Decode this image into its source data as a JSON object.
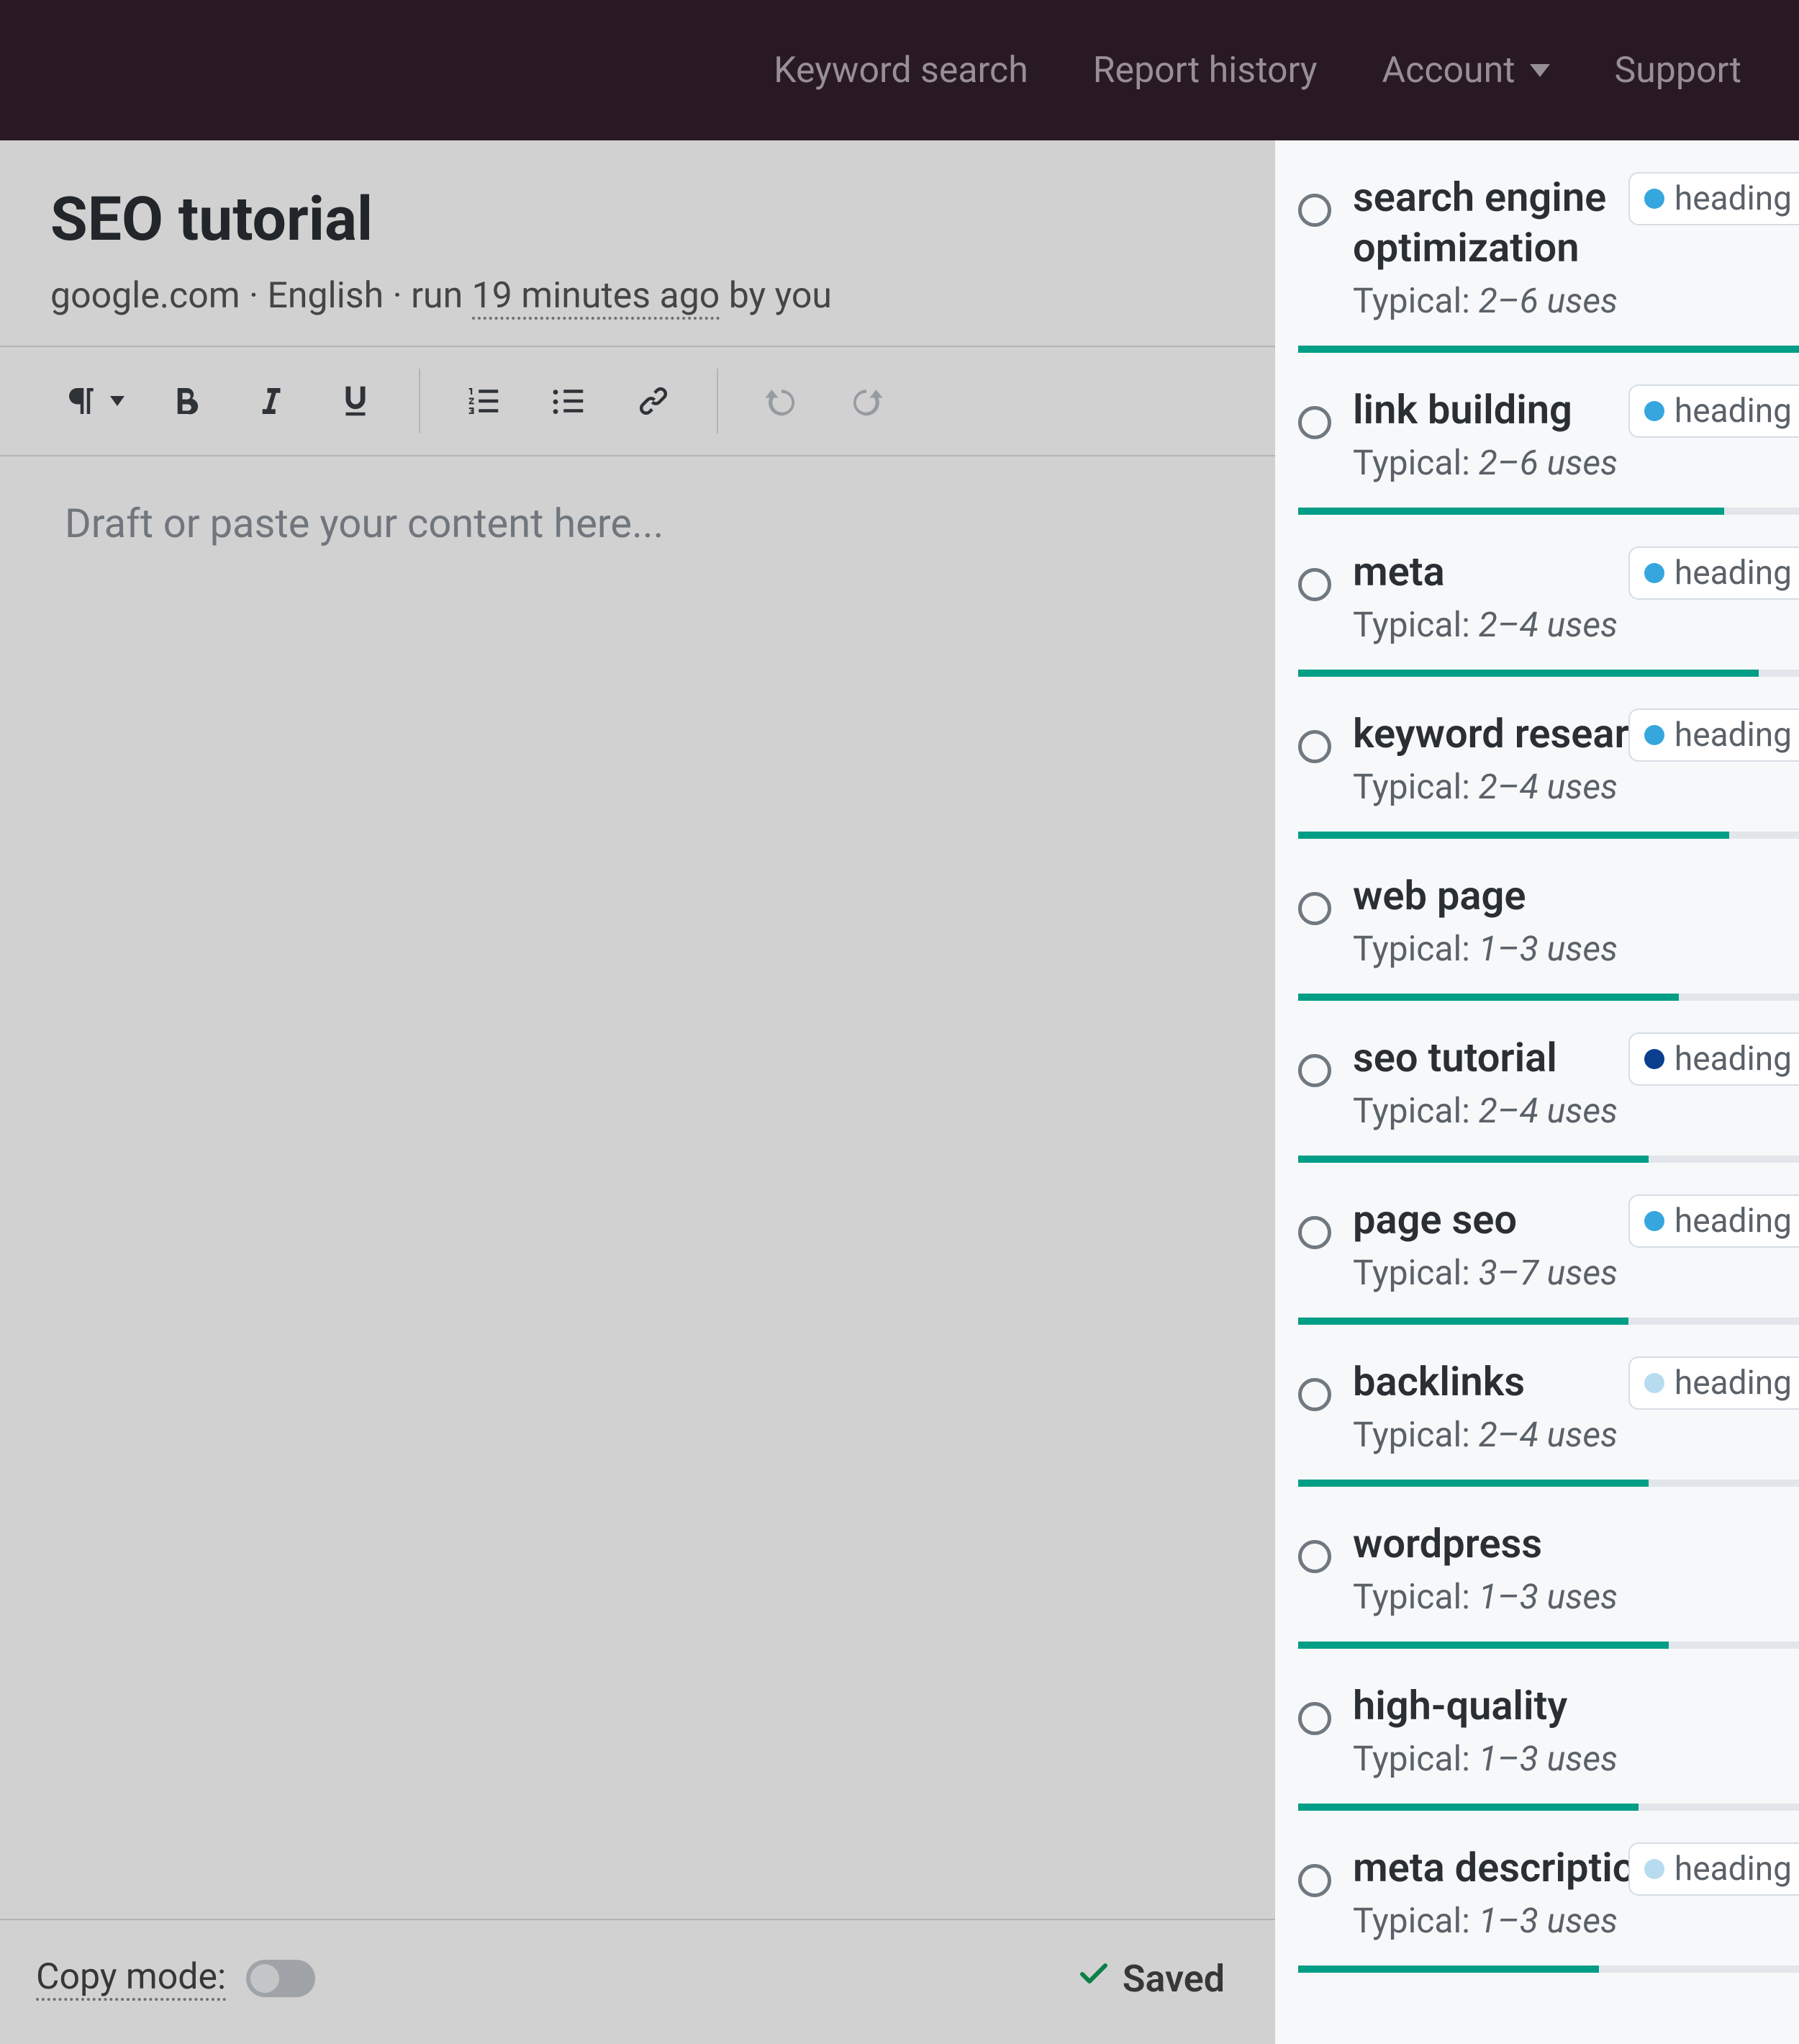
{
  "nav": {
    "keyword_search": "Keyword search",
    "report_history": "Report history",
    "account": "Account",
    "support": "Support"
  },
  "page": {
    "title": "SEO tutorial",
    "meta_domain": "google.com",
    "meta_lang": "English",
    "meta_run_prefix": "run",
    "meta_timestamp": "19 minutes ago",
    "meta_by": "by you",
    "editor_placeholder": "Draft or paste your content here...",
    "copy_mode_label": "Copy mode:",
    "saved_label": "Saved"
  },
  "keywords": [
    {
      "term": "search engine optimization",
      "usage_prefix": "Typical:",
      "usage_range": "2–6 uses",
      "badge": "heading",
      "badge_tone": "normal",
      "bar_pct": 100
    },
    {
      "term": "link building",
      "usage_prefix": "Typical:",
      "usage_range": "2–6 uses",
      "badge": "heading",
      "badge_tone": "normal",
      "bar_pct": 85
    },
    {
      "term": "meta",
      "usage_prefix": "Typical:",
      "usage_range": "2–4 uses",
      "badge": "heading",
      "badge_tone": "normal",
      "bar_pct": 92
    },
    {
      "term": "keyword research",
      "usage_prefix": "Typical:",
      "usage_range": "2–4 uses",
      "badge": "heading",
      "badge_tone": "normal",
      "bar_pct": 86
    },
    {
      "term": "web page",
      "usage_prefix": "Typical:",
      "usage_range": "1–3 uses",
      "badge": null,
      "badge_tone": null,
      "bar_pct": 76
    },
    {
      "term": "seo tutorial",
      "usage_prefix": "Typical:",
      "usage_range": "2–4 uses",
      "badge": "heading",
      "badge_tone": "dark",
      "bar_pct": 70
    },
    {
      "term": "page seo",
      "usage_prefix": "Typical:",
      "usage_range": "3–7 uses",
      "badge": "heading",
      "badge_tone": "normal",
      "bar_pct": 66
    },
    {
      "term": "backlinks",
      "usage_prefix": "Typical:",
      "usage_range": "2–4 uses",
      "badge": "heading",
      "badge_tone": "pale",
      "bar_pct": 70
    },
    {
      "term": "wordpress",
      "usage_prefix": "Typical:",
      "usage_range": "1–3 uses",
      "badge": null,
      "badge_tone": null,
      "bar_pct": 74
    },
    {
      "term": "high-quality",
      "usage_prefix": "Typical:",
      "usage_range": "1–3 uses",
      "badge": null,
      "badge_tone": null,
      "bar_pct": 68
    },
    {
      "term": "meta description",
      "usage_prefix": "Typical:",
      "usage_range": "1–3 uses",
      "badge": "heading",
      "badge_tone": "pale",
      "bar_pct": 60
    }
  ]
}
